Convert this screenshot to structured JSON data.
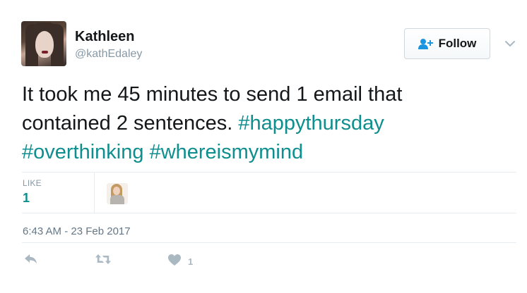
{
  "author": {
    "name": "Kathleen",
    "handle": "@kathEdaley"
  },
  "follow_button": {
    "label": "Follow",
    "icon": "add-user-icon"
  },
  "tweet": {
    "text_lines": [
      [
        {
          "text": "It took me 45 minutes to send 1 email that",
          "hashtag": false
        }
      ],
      [
        {
          "text": "contained 2 sentences. ",
          "hashtag": false
        },
        {
          "text": "#happythursday",
          "hashtag": true
        }
      ],
      [
        {
          "text": "#overthinking",
          "hashtag": true
        },
        {
          "text": " ",
          "hashtag": false
        },
        {
          "text": "#whereismymind",
          "hashtag": true
        }
      ]
    ],
    "timestamp": "6:43 AM - 23 Feb 2017"
  },
  "stats": {
    "likes_label": "LIKE",
    "likes_count": "1"
  },
  "actions": {
    "reply_icon": "reply-icon",
    "retweet_icon": "retweet-icon",
    "like_icon": "heart-icon",
    "like_count": "1"
  },
  "colors": {
    "hashtag": "#0e8e8e",
    "muted": "#8899a6",
    "text": "#14171a",
    "action_icon": "#aab8c2"
  }
}
